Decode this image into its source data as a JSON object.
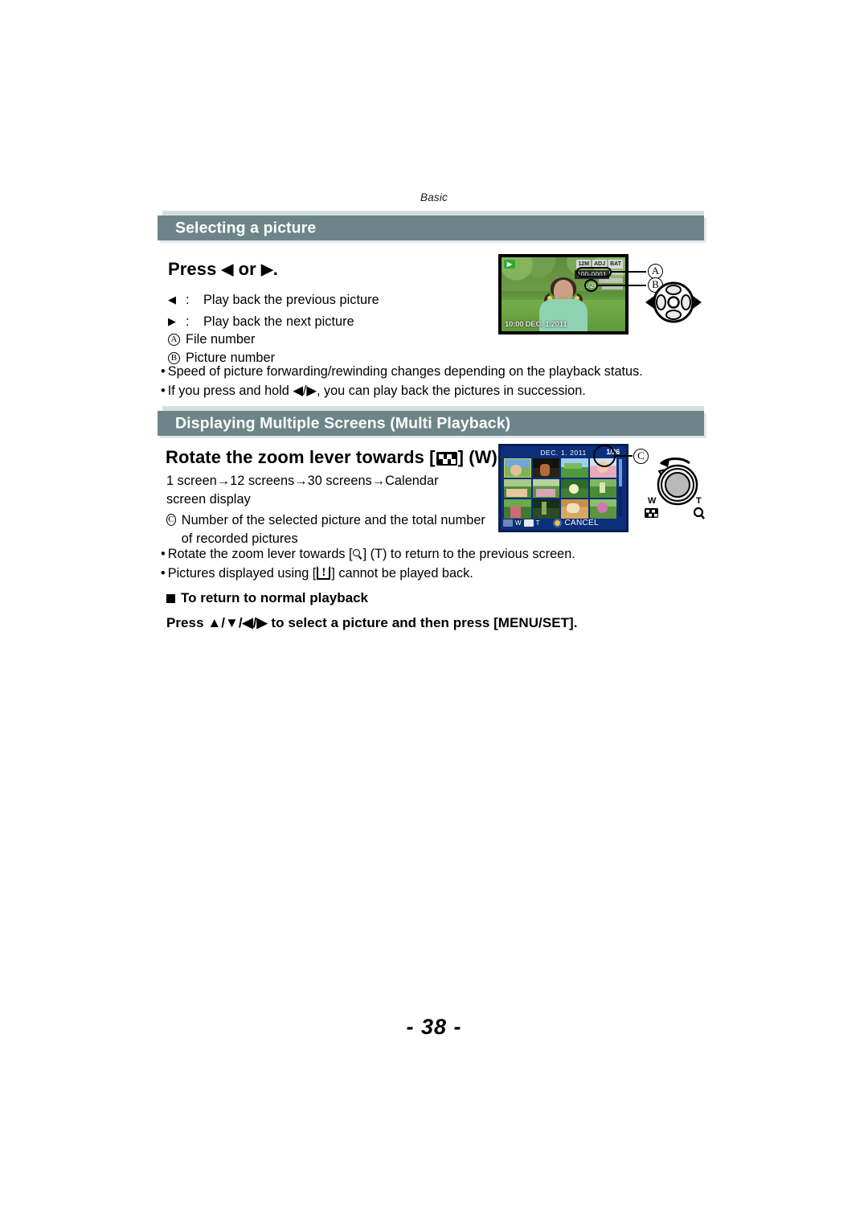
{
  "page": {
    "running_head": "Basic",
    "page_number": "- 38 -"
  },
  "sections": [
    {
      "id": "selecting-a-picture",
      "title": "Selecting a picture",
      "step_heading_pre": "Press ",
      "step_heading_left": "◀",
      "step_heading_mid": " or ",
      "step_heading_right": "▶",
      "step_heading_post": ".",
      "key_rows": [
        {
          "key": "◀",
          "sep": ":",
          "text": "Play back the previous picture"
        },
        {
          "key": "▶",
          "sep": ":",
          "text": "Play back the next picture"
        }
      ],
      "callouts": [
        {
          "mark": "A",
          "text": "File number"
        },
        {
          "mark": "B",
          "text": "Picture number"
        }
      ],
      "bullets": [
        "Speed of picture forwarding/rewinding changes depending on the playback status.",
        "If you press and hold ◀/▶, you can play back the pictures in succession."
      ]
    },
    {
      "id": "multi-playback",
      "title": "Displaying Multiple Screens (Multi Playback)",
      "step_heading_pre": "Rotate the zoom lever towards [",
      "step_heading_icon": "multi-screen-icon",
      "step_heading_post": "] (W).",
      "flow_text": "1 screen→12 screens→30 screens→Calendar screen display",
      "callout": {
        "mark": "C",
        "text": "Number of the selected picture and the total number of recorded pictures"
      },
      "bullets": [
        {
          "pre": "Rotate the zoom lever towards [",
          "icon": "magnifier-icon",
          "post": "] (T) to return to the previous screen."
        },
        {
          "pre": "Pictures displayed using [",
          "icon": "warning-icon",
          "post": "] cannot be played back."
        }
      ],
      "subsection": {
        "heading": "To return to normal playback",
        "body": "Press ▲/▼/◀/▶ to select a picture and then press [MENU/SET]."
      }
    }
  ],
  "illustrations": {
    "lcd_single": {
      "playback_badge": "▶",
      "top_icons": [
        "12M",
        "ADJ",
        "BAT"
      ],
      "file_number": "100-0001",
      "picture_number": "1/26",
      "timestamp": "10:00 DEC. 1.2011",
      "callout_a": "A",
      "callout_b": "B"
    },
    "lcd_multi": {
      "date": "DEC. 1. 2011",
      "counter": "1/26",
      "callout_c": "C",
      "bottom_bar": {
        "w_label": "W",
        "t_label": "T",
        "cancel_label": "CANCEL"
      },
      "thumbnail_count": 12,
      "selected_index": 0,
      "thumbnails": [
        {
          "top": "#6fa8d8",
          "bot": "#7cb356",
          "subject": "#e2c09a"
        },
        {
          "top": "#14140f",
          "bot": "#2a2418",
          "subject": "#b46a3a"
        },
        {
          "top": "#9ecff0",
          "bot": "#4e9a3c",
          "subject": "#79b85a"
        },
        {
          "top": "#cfe3ef",
          "bot": "#e8a9bd",
          "subject": "#f0c9a8"
        },
        {
          "top": "#a6c98e",
          "bot": "#4f8a3a",
          "subject": "#e6c6a2"
        },
        {
          "top": "#b7d49c",
          "bot": "#5c9440",
          "subject": "#d9a4b4"
        },
        {
          "top": "#2f6a2a",
          "bot": "#437f33",
          "subject": "#f2f2c0"
        },
        {
          "top": "#7fb563",
          "bot": "#4b8b36",
          "subject": "#d8e3b0"
        },
        {
          "top": "#6ea94f",
          "bot": "#3f7a2e",
          "subject": "#d06a7a"
        },
        {
          "top": "#17301a",
          "bot": "#2b4a25",
          "subject": "#88a861"
        },
        {
          "top": "#c98f4a",
          "bot": "#d9a85f",
          "subject": "#efe0c0"
        },
        {
          "top": "#8bbf6a",
          "bot": "#5d9341",
          "subject": "#cf77b0"
        }
      ]
    },
    "zoom_lever": {
      "w_label": "W",
      "t_label": "T",
      "w_icon": "multi-screen-icon",
      "t_icon": "magnifier-icon"
    },
    "cursor_button": {
      "left_arrow": "◀",
      "right_arrow": "▶"
    }
  },
  "colors": {
    "section_bar": "#6d8589",
    "section_bar_top_strip": "#d3dfdf",
    "section_bar_shadow": "#e2e6ec",
    "lcd_multi_bg": "#0b2f7a",
    "text": "#000000"
  }
}
